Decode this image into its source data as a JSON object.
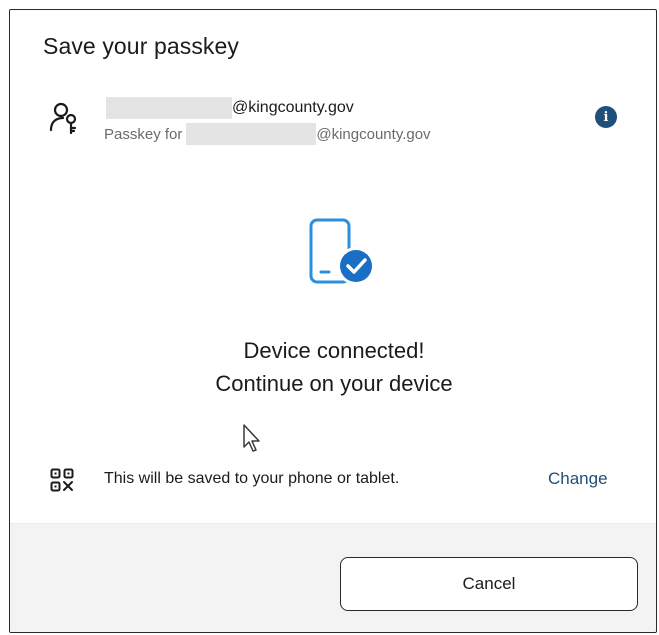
{
  "dialog": {
    "title": "Save your passkey"
  },
  "account": {
    "email_suffix": "@kingcounty.gov",
    "passkey_prefix": "Passkey for",
    "passkey_suffix": "@kingcounty.gov",
    "icon": "key-user-icon",
    "info_icon": "info-icon",
    "info_glyph": "i"
  },
  "status": {
    "icon": "phone-check-icon",
    "line1": "Device connected!",
    "line2": "Continue on your device"
  },
  "save_location": {
    "icon": "qr-code-icon",
    "text": "This will be saved to your phone or tablet.",
    "change_label": "Change"
  },
  "footer": {
    "cancel_label": "Cancel"
  },
  "colors": {
    "accent": "#1f4f7a",
    "device_blue": "#2b8fe0",
    "footer_bg": "#f3f3f3"
  }
}
